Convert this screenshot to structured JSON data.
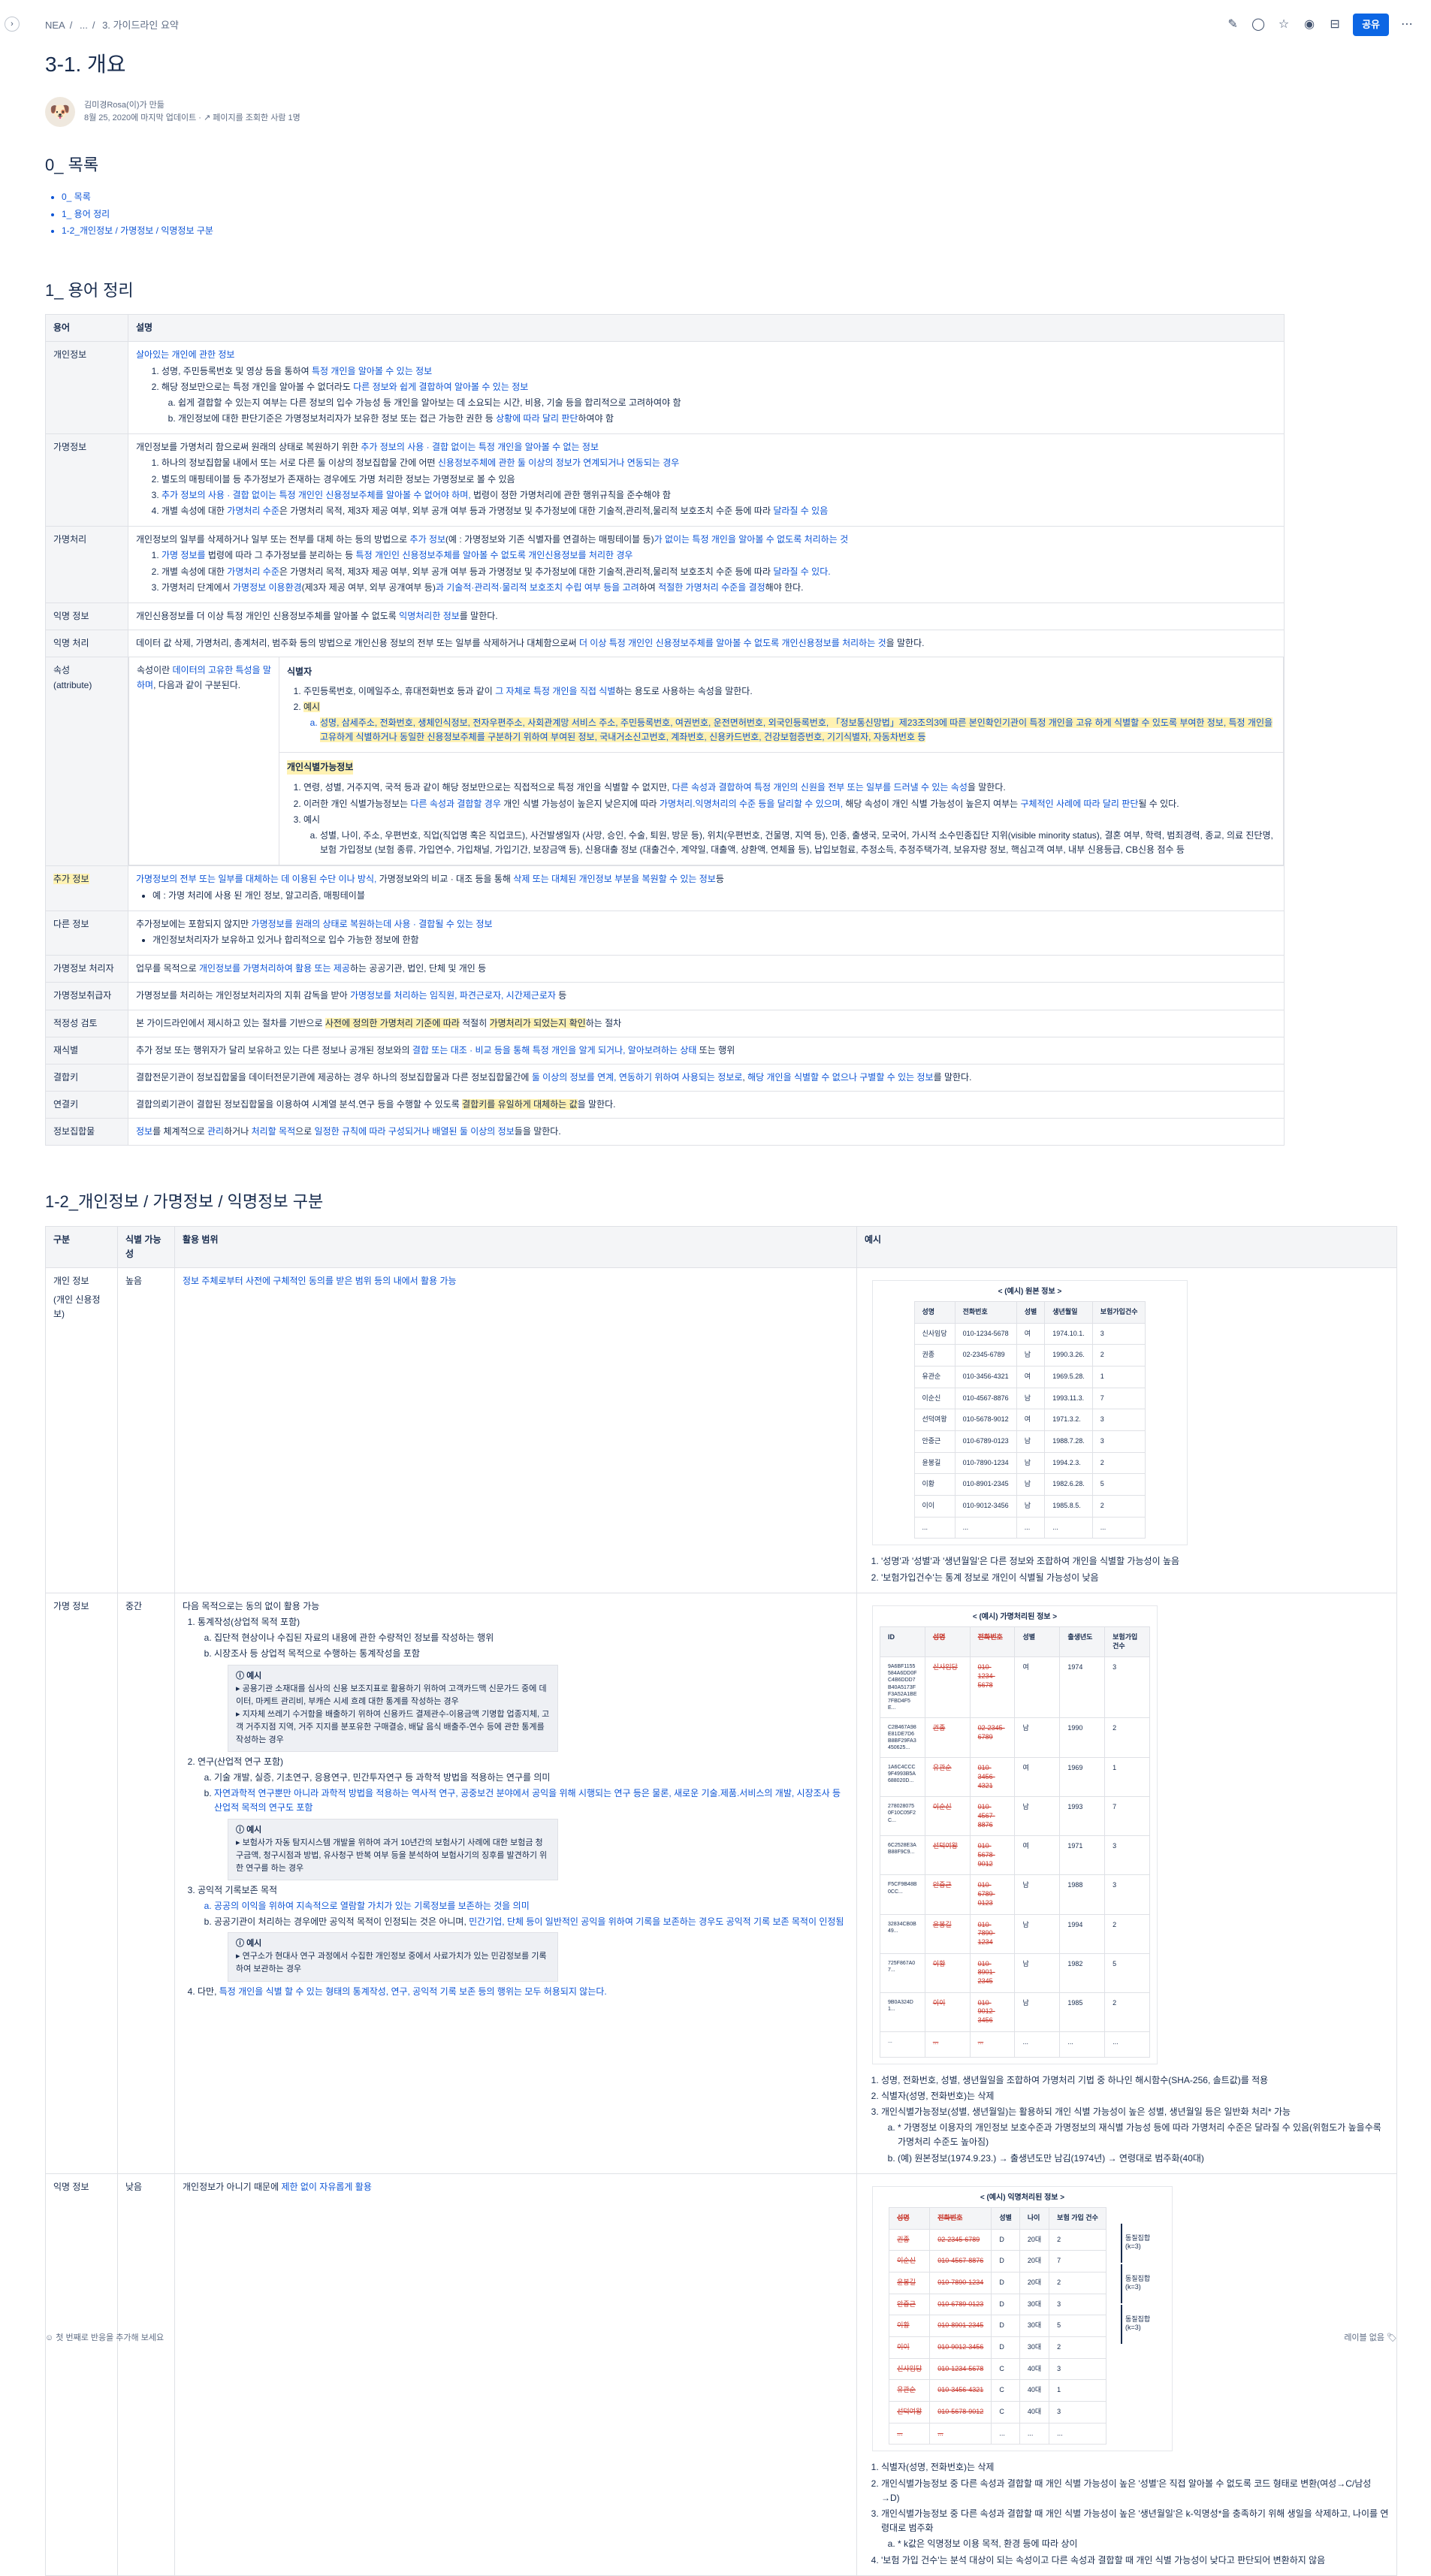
{
  "topbar": {
    "breadcrumbs": [
      "NEA",
      "...",
      "3. 가이드라인 요약"
    ],
    "share_label": "공유",
    "expand_glyph": "›",
    "icons": [
      "pen-icon",
      "comment-icon",
      "star-icon",
      "eye-icon",
      "restriction-icon",
      "more-icon"
    ]
  },
  "page": {
    "title": "3-1. 개요",
    "author_line": "김미경Rosa(이)가 만듦",
    "date_line": "8월 25, 2020에 마지막 업데이트 ·",
    "views_line": "페이지를 조회한 사람 1명"
  },
  "toc": {
    "title": "0_ 목록",
    "items": [
      "0_ 목록",
      "1_ 용어 정리",
      "1-2_개인정보 / 가명정보 / 익명정보 구분"
    ]
  },
  "glossary": {
    "title": "1_ 용어 정리",
    "headers": [
      "용어",
      "설명"
    ],
    "personal": {
      "term": "개인정보",
      "intro": "살아있는 개인에 관한 정보",
      "l1a": "성명, 주민등록번호 및 영상 등을 통하여 ",
      "l1b": "특정 개인을 알아볼 수 있는 정보",
      "l2a": "해당 정보만으로는 특정 개인을 알아볼 수 없더라도 ",
      "l2b": "다른 정보와 쉽게 결합하여 알아볼 수 있는 정보",
      "la": "쉽게 결합할 수 있는지 여부는 다른 정보의 입수 가능성 등 개인을 알아보는 데 소요되는 시간, 비용, 기술 등을 합리적으로 고려하여야 함",
      "lb1": "개인정보에 대한 판단기준은 가명정보처리자가 보유한 정보 또는 접근 가능한 권한 등 ",
      "lb2": "상황에 따라 달리 판단",
      "lb3": "하여야 함"
    },
    "pseudo": {
      "term": "가명정보",
      "intro1": "개인정보를 가명처리 함으로써 원래의 상태로 복원하기 위한 ",
      "intro2": "추가 정보의 사용 · 결합 없이는 특정 개인을 알아볼 수 없는 정보",
      "l1a": "하나의 정보집합물 내에서 또는 서로 다른 둘 이상의 정보집합물 간에 어떤 ",
      "l1b": "신용정보주체에 관한 둘 이상의 정보가 연계되거나 연동되는 경우",
      "l2": "별도의 매핑테이블 등 추가정보가 존재하는 경우에도 가명 처리한 정보는 가명정보로 볼 수 있음",
      "l3a": "추가 정보의 사용 · 결합 없이는 특정 개인인 신용정보주체를 알아볼 수 없어야 하며,",
      "l3b": " 법령이 정한 가명처리에 관한 행위규칙을 준수해야 함",
      "l4a": "개별 속성에 대한 ",
      "l4b": "가명처리 수준",
      "l4c": "은 가명처리 목적, 제3자 제공 여부, 외부 공개 여부 등과 가명정보 및 추가정보에 대한 기술적,관리적,물리적 보호조치 수준 등에 따라 ",
      "l4d": "달라질 수 있음"
    },
    "pproc": {
      "term": "가명처리",
      "intro1": "개인정보의 일부를 삭제하거나 일부 또는 전부를 대체 하는 등의 방법으로 ",
      "intro2": "추가 정보",
      "intro3": "(예 : 가명정보와 기존 식별자를 연결하는 매핑테이블 등)",
      "intro4": "가 없이는 특정 개인을 알아볼 수 없도록 처리하는 것",
      "l1a": "가명 정보를",
      "l1b": " 법령에 따라 그 추가정보를 분리하는 등 ",
      "l1c": "특정 개인인 신용정보주체를 알아볼 수 없도록 개인신용정보를 처리한 경우",
      "l2a": "개별 속성에 대한 ",
      "l2b": "가명처리 수준",
      "l2c": "은 가명처리 목적, 제3자 제공 여부, 외부 공개 여부 등과 가명정보 및 추가정보에 대한 기술적,관리적,물리적 보호조치 수준 등에 따라 ",
      "l2d": "달라질 수 있다.",
      "l3a": "가명처리 단계에서 ",
      "l3b": "가명정보 이용환경",
      "l3c": "(제3자 제공 여부, 외부 공개여부 등)",
      "l3d": "과 기술적·관리적·물리적 보호조치 수립 여부 등을 고려",
      "l3e": "하여 ",
      "l3f": "적절한 가명처리 수준을 결정",
      "l3g": "해야 한다."
    },
    "anon": {
      "term": "익명 정보",
      "text1": "개인신용정보를 더 이상 특정 개인인 신용정보주체를 알아볼 수 없도록 ",
      "text2": "익명처리한 정보",
      "text3": "를 말한다."
    },
    "aproc": {
      "term": "익명 처리",
      "text1": "데이터 값 삭제, 가명처리, 총계처리, 범주화 등의 방법으로 개인신용 정보의 전부 또는 일부를 삭제하거나 대체함으로써 ",
      "text2": "더 이상 특정 개인인 신용정보주체를 알아볼 수 없도록 개인신용정보를 처리하는 것",
      "text3": "을 말한다."
    },
    "attr": {
      "term": "속성\n(attribute)",
      "d1": "속성이란 ",
      "d2": "데이터의 고유한 특성을 말하며",
      "d3": ", 다음과 같이 구분된다.",
      "id_label": "식별자",
      "id_l1a": "주민등록번호, 이메일주소, 휴대전화번호 등과 같이 ",
      "id_l1b": "그 자체로 특정 개인을 직접 식별",
      "id_l1c": "하는 용도로 사용하는 속성을 말한다.",
      "id_l2": "예시",
      "id_la": "성명, 삼세주소, 전화번호, 생체인식정보, 전자우편주소, 사회관계망 서비스 주소, 주민등록번호, 여권번호, 운전면허번호, 외국인등록번호, 「정보통신망법」제23조의3에 따른 본인확인기관이 특정 개인을 고유 하게 식별할 수 있도록 부여한 정보, 특정 개인을 고유하게 식별하거나 동일한 신용정보주체를 구분하기 위하여 부여된 정보, 국내거소신고번호, 계좌번호, 신용카드번호, 건강보험증번호, 기기식별자, 자동차번호 등",
      "q_label": "개인식별가능정보",
      "q_l1a": "연령, 성별, 거주지역, 국적 등과 같이 해당 정보만으로는 직접적으로 특정 개인을 식별할 수 없지만, ",
      "q_l1b": "다른 속성과 결합하여 특정 개인의 신원을 전부 또는 일부를 드러낼 수 있는 속성",
      "q_l1c": "을 말한다.",
      "q_l2a": "이러한 개인 식별가능정보는 ",
      "q_l2b": "다른 속성과 결합할 경우",
      "q_l2c": " 개인 식별 가능성이 높은지 낮은지에 따라 ",
      "q_l2d": "가명처리.익명처리의 수준 등을 달리할 수 있으며,",
      "q_l2e": " 해당 속성이 개인 식별 가능성이 높은지 여부는 ",
      "q_l2f": "구체적인 사례에 따라 달리 판단",
      "q_l2g": "될 수 있다.",
      "q_l3": "예시",
      "q_la": "성별, 나이, 주소, 우편번호, 직업(직업명 혹은 직업코드), 사건발생일자 (사망, 승인, 수술, 퇴원, 방문 등), 위치(우편번호, 건물명, 지역 등), 인종, 출생국, 모국어, 가시적 소수민종집단 지위(visible minority status), 결혼 여부, 학력, 범죄경력, 종교, 의료 진단명, 보험 가입정보 (보험 종류, 가입연수, 가입채널, 가입기간, 보장금액 등), 신용대출 정보 (대출건수, 계약일, 대출액, 상환액, 연체율 등), 납입보험료, 추정소득, 추정주택가격, 보유자량 정보, 핵심고객 여부, 내부 신용등급, CB신용 점수 등"
    },
    "addinfo": {
      "term": "추가 정보",
      "d1": "가명정보의 전부 또는 일부를 대체하는 데 이용된 수단 이나 방식,",
      "d2": " 가명정보와의 비교 · 대조 등을 통해 ",
      "d3": "삭제 또는 대체된 개인정보 부분을 복원할 수 있는 정보",
      "d4": "등",
      "b1": "예 : 가명 처리에 사용 된 개인 정보, 알고리즘, 매핑테이블"
    },
    "other": {
      "term": "다른 정보",
      "d1": "추가정보에는 포함되지 않지만 ",
      "d2": "가명정보를 원래의 상태로 복원하는데 사용 · 결합될 수 있는 정보",
      "b1": "개인정보처리자가 보유하고 있거나 합리적으로 입수 가능한 정보에 한함"
    },
    "handler": {
      "term": "가명정보 처리자",
      "d1": "업무를 목적으로 ",
      "d2": "개인정보를 가명처리하여 활용 또는 제공",
      "d3": "하는 공공기관, 법인, 단체 및 개인 등"
    },
    "manager": {
      "term": "가명정보취급자",
      "d1": "가명정보를 처리하는 개인정보처리자의 지휘 감독을 받아 ",
      "d2": "가명정보를 처리하는 임직원, 파견근로자, 시간제근로자",
      "d3": " 등"
    },
    "review": {
      "term": "적정성 검토",
      "d1": "본 가이드라인에서 제시하고 있는 절차를 기반으로 ",
      "d2": "사전에 정의한 가명처리 기준에 따라",
      "d3": " 적절히 ",
      "d4": "가명처리가 되었는지 확인",
      "d5": "하는 절차"
    },
    "reid": {
      "term": "재식별",
      "d1": "추가 정보 또는 행위자가 달리 보유하고 있는 다른 정보나 공개된 정보와의 ",
      "d2": "결합 또는 대조 · 비교 등을 통해 특정 개인을 알게 되거나, 알아보려하는 상태",
      "d3": " 또는 행위"
    },
    "combiner": {
      "term": "결합키",
      "d1": "결합전문기관이 정보집합물을 데이터전문기관에 제공하는 경우 하나의 정보집합물과 다른 정보집합물간에 ",
      "d2": "둘 이상의 정보를 연계, 연동하기 위하여 사용되는 정보로",
      "d3": ", ",
      "d4": "해당 개인을 식별할 수 없으나 구별할 수 있는 정보",
      "d5": "를 말한다."
    },
    "linkkey": {
      "term": "연결키",
      "d1": "결합의뢰기관이 결합된 정보집합물을 이용하여 시계열 분석.연구 등을 수행할 수 있도록 ",
      "d2": "결합키를 유일하게 대체하는 값",
      "d3": "을 말한다."
    },
    "dataset": {
      "term": "정보집합물",
      "d1": "정보",
      "d2": "를 체계적으로 ",
      "d3": "관리",
      "d4": "하거나 ",
      "d5": "처리할 목적",
      "d6": "으로 ",
      "d7": "일정한 규칙에 따라 구성되거나 배열된 둘 이상의 정보",
      "d8": "들을 말한다."
    }
  },
  "compare": {
    "title": "1-2_개인정보 / 가명정보 / 익명정보 구분",
    "headers": [
      "구분",
      "식별 가능성",
      "활용 범위",
      "예시"
    ],
    "personal": {
      "kind": "개인 정보",
      "kind2": "(개인 신용정보)",
      "level": "높음",
      "scope": "정보 주체로부터 사전에 구체적인 동의를 받은 범위 등의 내에서 활용 가능",
      "img_title": "< (예시) 원본 정보 >",
      "img_headers": [
        "성명",
        "전화번호",
        "성별",
        "생년월일",
        "보험가입건수"
      ],
      "img_rows": [
        [
          "신사임당",
          "010-1234-5678",
          "여",
          "1974.10.1.",
          "3"
        ],
        [
          "권종",
          "02-2345-6789",
          "남",
          "1990.3.26.",
          "2"
        ],
        [
          "유관순",
          "010-3456-4321",
          "여",
          "1969.5.28.",
          "1"
        ],
        [
          "이순신",
          "010-4567-8876",
          "남",
          "1993.11.3.",
          "7"
        ],
        [
          "선덕여왕",
          "010-5678-9012",
          "여",
          "1971.3.2.",
          "3"
        ],
        [
          "안중근",
          "010-6789-0123",
          "남",
          "1988.7.28.",
          "3"
        ],
        [
          "윤봉길",
          "010-7890-1234",
          "남",
          "1994.2.3.",
          "2"
        ],
        [
          "이황",
          "010-8901-2345",
          "남",
          "1982.6.28.",
          "5"
        ],
        [
          "이이",
          "010-9012-3456",
          "남",
          "1985.8.5.",
          "2"
        ],
        [
          "...",
          "...",
          "...",
          "...",
          "..."
        ]
      ],
      "n1": "'성명'과 '성별'과 '생년월일'은 다른 정보와 조합하여 개인을 식별할 가능성이 높음",
      "n2": "'보험가입건수'는 통계 정보로 개인이 식별될 가능성이 낮음"
    },
    "pseudo": {
      "kind": "가명 정보",
      "level": "중간",
      "intro": "다음 목적으로는 동의 없이 활용 가능",
      "p1": "통계작성(상업적 목적 포함)",
      "p1a": "집단적 현상이나 수집된 자료의 내용에 관한 수량적인 정보를 작성하는 행위",
      "p1b": "시장조사 등 상업적 목적으로 수행하는 통계작성을 포함",
      "ex_label": "예시",
      "ex1a": "공용기관 소재대를 심사의 신용 보조지표로 활용하기 위하여 고객카드맥 신문가드 중에 데이터, 마케트 관리비, 부캐슨 시세 흐례 대한 통계를 작성하는 경우",
      "ex1b": "지자체 쓰레기 수거함을 배출하기 위하여 신용카드 결제관수-이용금액 기명합 업종지체, 고객 거주지점 지역, 거주 지지를 분포유한 구매결승, 배달 음식 배출주-연수 등에 관한 통계를 작성하는 경우",
      "p2": "연구(산업적 연구 포함)",
      "p2a": "기술 개발, 실증, 기초연구, 응용연구, 민간투자연구 등 과학적 방법을 적용하는 연구를 의미",
      "p2b1": "자연과학적 연구뿐만 아니라 과학적 방법을 적용하는 역사적 연구, 공중보건 분야에서 공익을 위해 시행되는 연구 등은 물론, 새로운 기술.제품.서비스의 개발, 시장조사 등 ",
      "p2b2": "산업적 목적의 연구도 포함",
      "ex2": "보험사가 자동 탐지시스템 개발을 위하여 과거 10년간의 보험사기 사례에 대한 보험금 청구금액, 청구시점과 방법, 유사청구 반복 여부 등을 분석하여 보험사기의 징후를 발견하기 위한 연구를 하는 경우",
      "p3": "공익적 기록보존 목적",
      "p3a": "공공의 이익을 위하여 지속적으로 열람할 가치가 있는 기록정보를 보존하는 것을 의미",
      "p3b1": "공공기관이 처리하는 경우에만 공익적 목적이 인정되는 것은 아니며, ",
      "p3b2": "민간기업, 단체 등이 일반적인 공익을 위하여 기록을 보존하는 경우도 공익적 기록 보존 목적이 인정됨",
      "ex3": "연구소가 현대사 연구 과정에서 수집한 개인정보 중에서 사료가치가 있는 민감정보를 기록하여 보관하는 경우",
      "p4a": "다만, ",
      "p4b": "특정 개인을 식별 할 수 있는 형태의 통계작성, 연구, 공익적 기록 보존 등의 행위는 모두 허용되지 않는다.",
      "img_title": "< (예시) 가명처리된 정보 >",
      "img_headers": [
        "ID",
        "성명",
        "전화번호",
        "성별",
        "출생년도",
        "보험가입건수"
      ],
      "img_rows": [
        [
          "9A6BF1155584A6DD0FC4B6DDD7B40A5173FF3A52A1BE7FBD4F5E...",
          "신사임당",
          "010-1234-5678",
          "여",
          "1974",
          "3"
        ],
        [
          "C2B467A98E81DE7D6B8BF29FA3450625...",
          "권종",
          "02-2345-6789",
          "남",
          "1990",
          "2"
        ],
        [
          "1A6C4CCC9F4993B5A688020D...",
          "유관순",
          "010-3456-4321",
          "여",
          "1969",
          "1"
        ],
        [
          "2780280750F10C05F2C...",
          "이순신",
          "010-4567-8876",
          "남",
          "1993",
          "7"
        ],
        [
          "6C2528E3AB88F9C9...",
          "선덕여왕",
          "010-5678-9012",
          "여",
          "1971",
          "3"
        ],
        [
          "F5CF9B48B0CC...",
          "안중근",
          "010-6789-0123",
          "남",
          "1988",
          "3"
        ],
        [
          "32834CB0B49...",
          "윤봉길",
          "010-7890-1234",
          "남",
          "1994",
          "2"
        ],
        [
          "725F867A07...",
          "이황",
          "010-8901-2345",
          "남",
          "1982",
          "5"
        ],
        [
          "9B0A324D1...",
          "이이",
          "010-9012-3456",
          "남",
          "1985",
          "2"
        ],
        [
          "...",
          "...",
          "...",
          "...",
          "...",
          "..."
        ]
      ],
      "n1": "성명, 전화번호, 성별, 생년월일을 조합하여 가명처리 기법 중 하나인 해시함수(SHA-256, 솔트값)를 적용",
      "n2": "식별자(성명, 전화번호)는 삭제",
      "n3": "개인식별가능정보(성별, 생년월일)는 활용하되 개인 식별 가능성이 높은 성별, 생년월일 등은 일반화 처리* 가능",
      "n3a": "* 가명정보 이용자의 개인정보 보호수준과 가명정보의 재식별 가능성 등에 따라 가명처리 수준은 달라질 수 있음(위험도가 높을수록 가명처리 수준도 높아짐)",
      "n3b": "(예) 원본정보(1974.9.23.) → 출생년도만 남김(1974년) → 연령대로 범주화(40대)"
    },
    "anon": {
      "kind": "익명 정보",
      "level": "낮음",
      "scope1": "개인정보가 아니기 때문에 ",
      "scope2": "제한 없이 자유롭게 활용",
      "img_title": "< (예시) 익명처리된 정보 >",
      "img_headers": [
        "성명",
        "전화번호",
        "성별",
        "나이",
        "보험 가입 건수"
      ],
      "img_rows": [
        [
          "권종",
          "02-2345-6789",
          "D",
          "20대",
          "2"
        ],
        [
          "이순신",
          "010-4567-8876",
          "D",
          "20대",
          "7"
        ],
        [
          "윤봉길",
          "010-7890-1234",
          "D",
          "20대",
          "2"
        ],
        [
          "안중근",
          "010-6789-0123",
          "D",
          "30대",
          "3"
        ],
        [
          "이황",
          "010-8901-2345",
          "D",
          "30대",
          "5"
        ],
        [
          "이이",
          "010-9012-3456",
          "D",
          "30대",
          "2"
        ],
        [
          "신사임당",
          "010-1234-5678",
          "C",
          "40대",
          "3"
        ],
        [
          "유관순",
          "010-3456-4321",
          "C",
          "40대",
          "1"
        ],
        [
          "선덕여왕",
          "010-5678-9012",
          "C",
          "40대",
          "3"
        ],
        [
          "...",
          "...",
          "...",
          "...",
          "..."
        ]
      ],
      "grp": "동질집합\n(k=3)",
      "n1": "식별자(성명, 전화번호)는 삭제",
      "n2": "개인식별가능정보 중 다른 속성과 결합할 때 개인 식별 가능성이 높은 '성별'은 직접 알아볼 수 없도록 코드 형태로 변환(여성→C/남성→D)",
      "n3": "개인식별가능정보 중 다른 속성과 결합할 때 개인 식별 가능성이 높은 '생년월일'은 k-익명성*을 충족하기 위해 생일을 삭제하고, 나이를 연령대로 범주화",
      "n3a": "* k값은 익명정보 이용 목적, 환경 등에 따라 상이",
      "n4": "'보험 가입 건수'는 분석 대상이 되는 속성이고 다른 속성과 결합할 때 개인 식별 가능성이 낮다고 판단되어 변환하지 않음"
    }
  },
  "footer": {
    "reaction": "첫 번째로 반응을 추가해 보세요",
    "labels": "레이블 없음"
  }
}
